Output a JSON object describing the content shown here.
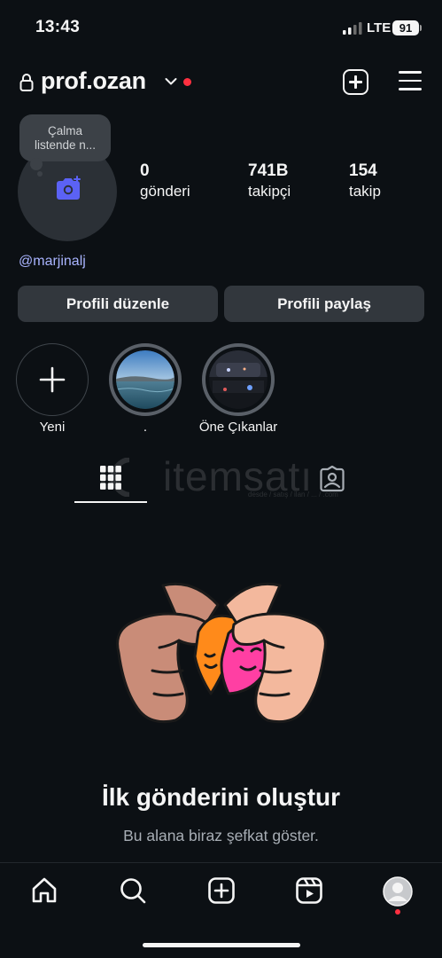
{
  "status_bar": {
    "time": "13:43",
    "network": "LTE",
    "battery": "91"
  },
  "header": {
    "username": "prof.ozan"
  },
  "note": {
    "text_line1": "Çalma",
    "text_line2": "listende n..."
  },
  "stats": [
    {
      "value": "0",
      "label": "gönderi"
    },
    {
      "value": "741B",
      "label": "takipçi"
    },
    {
      "value": "154",
      "label": "takip"
    }
  ],
  "profile": {
    "handle": "@marjinalj"
  },
  "buttons": {
    "edit": "Profili düzenle",
    "share": "Profili paylaş"
  },
  "highlights": [
    {
      "label": "Yeni"
    },
    {
      "label": "."
    },
    {
      "label": "Öne Çıkanlar"
    }
  ],
  "watermark": {
    "text": "itemsatı",
    "sub": "desde / satış / ilan / ... / .com"
  },
  "empty_state": {
    "title": "İlk gönderini oluştur",
    "subtitle": "Bu alana biraz şefkat göster."
  },
  "nav": [
    "home-icon",
    "search-icon",
    "create-icon",
    "reels-icon",
    "profile-avatar-icon"
  ],
  "colors": {
    "background": "#0c1014",
    "button": "#32373d",
    "link": "#a9b4ff",
    "notification": "#ff3040",
    "camera_accent": "#5b62f5"
  }
}
